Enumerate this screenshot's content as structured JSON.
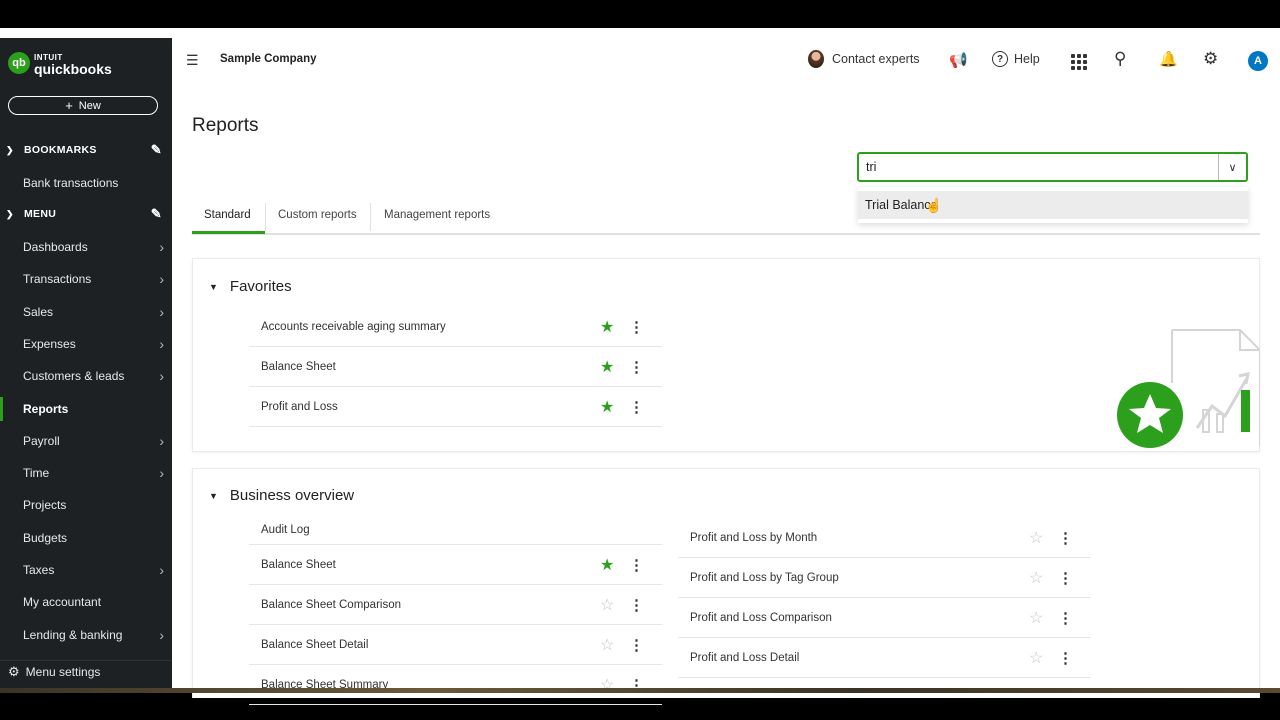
{
  "app": {
    "brand_top": "INTUIT",
    "brand_main": "quickbooks",
    "company": "Sample Company"
  },
  "sidebar": {
    "new_label": "New",
    "bookmarks_label": "BOOKMARKS",
    "bookmarks": [
      {
        "label": "Bank transactions"
      }
    ],
    "menu_label": "MENU",
    "items": [
      {
        "label": "Dashboards",
        "arrow": true
      },
      {
        "label": "Transactions",
        "arrow": true
      },
      {
        "label": "Sales",
        "arrow": true
      },
      {
        "label": "Expenses",
        "arrow": true
      },
      {
        "label": "Customers & leads",
        "arrow": true
      },
      {
        "label": "Reports",
        "arrow": false,
        "active": true
      },
      {
        "label": "Payroll",
        "arrow": true
      },
      {
        "label": "Time",
        "arrow": true
      },
      {
        "label": "Projects",
        "arrow": false
      },
      {
        "label": "Budgets",
        "arrow": false
      },
      {
        "label": "Taxes",
        "arrow": true
      },
      {
        "label": "My accountant",
        "arrow": false
      },
      {
        "label": "Lending & banking",
        "arrow": true
      }
    ],
    "menu_settings": "Menu settings"
  },
  "topbar": {
    "contact_experts": "Contact experts",
    "help": "Help",
    "avatar_letter": "A"
  },
  "page": {
    "title": "Reports"
  },
  "search": {
    "value": "tri",
    "suggestion": "Trial Balance"
  },
  "tabs": [
    {
      "label": "Standard"
    },
    {
      "label": "Custom reports"
    },
    {
      "label": "Management reports"
    }
  ],
  "favorites": {
    "title": "Favorites",
    "rows": [
      {
        "label": "Accounts receivable aging summary",
        "starred": true
      },
      {
        "label": "Balance Sheet",
        "starred": true
      },
      {
        "label": "Profit and Loss",
        "starred": true
      }
    ]
  },
  "business_overview": {
    "title": "Business overview",
    "left": [
      {
        "label": "Audit Log"
      },
      {
        "label": "Balance Sheet",
        "starred": true
      },
      {
        "label": "Balance Sheet Comparison",
        "starred": false
      },
      {
        "label": "Balance Sheet Detail",
        "starred": false
      },
      {
        "label": "Balance Sheet Summary",
        "starred": false
      }
    ],
    "right": [
      {
        "label": "Profit and Loss by Month",
        "starred": false
      },
      {
        "label": "Profit and Loss by Tag Group",
        "starred": false
      },
      {
        "label": "Profit and Loss Comparison",
        "starred": false
      },
      {
        "label": "Profit and Loss Detail",
        "starred": false
      }
    ]
  },
  "colors": {
    "accent": "#2ca01c",
    "sidebar_bg": "#1e2124",
    "avatar_bg": "#0077c5"
  }
}
